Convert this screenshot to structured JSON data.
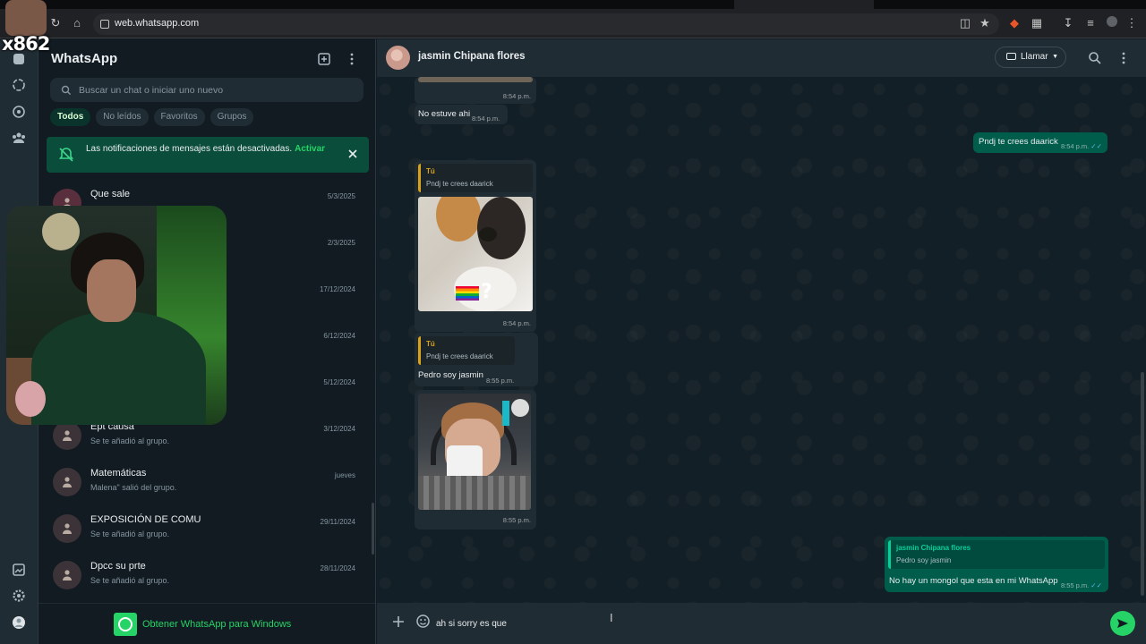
{
  "browser": {
    "url": "web.whatsapp.com"
  },
  "sidebar": {
    "title": "WhatsApp",
    "search_placeholder": "Buscar un chat o iniciar uno nuevo",
    "filters": [
      "Todos",
      "No leídos",
      "Favoritos",
      "Grupos"
    ],
    "active_filter": "Todos",
    "notice": {
      "text": "Las notificaciones de mensajes están desactivadas.",
      "link": "Activar"
    },
    "chats": [
      {
        "name": "Que sale",
        "preview": "",
        "date": "5/3/2025"
      },
      {
        "name": "",
        "preview": "",
        "date": "2/3/2025"
      },
      {
        "name": "",
        "preview": "",
        "date": "17/12/2024"
      },
      {
        "name": "",
        "preview": "",
        "date": "6/12/2024"
      },
      {
        "name": "",
        "preview": "",
        "date": "5/12/2024"
      },
      {
        "name": "Ept causa",
        "preview": "Se te añadió al grupo.",
        "date": "3/12/2024"
      },
      {
        "name": "Matemáticas",
        "preview": "Malena\" salió del grupo.",
        "date": "jueves"
      },
      {
        "name": "EXPOSICIÓN DE COMU",
        "preview": "Se te añadió al grupo.",
        "date": "29/11/2024"
      },
      {
        "name": "Dpcc su prte",
        "preview": "Se te añadió al grupo.",
        "date": "28/11/2024"
      }
    ],
    "footer_text": "Obtener WhatsApp para Windows"
  },
  "streamer": {
    "label": "x862"
  },
  "conversation": {
    "contact_name": "jasmin Chipana flores",
    "call_label": "Llamar",
    "messages": {
      "m1_time": "8:54 p.m.",
      "m2_text": "No estuve ahi",
      "m2_time": "8:54 p.m.",
      "m3_text": "Pndj te crees daarick",
      "m3_time": "8:54 p.m.",
      "m4_quote_author": "Tú",
      "m4_quote_text": "Pndj te crees daarick",
      "m4_time": "8:54 p.m.",
      "m5_quote_author": "Tú",
      "m5_quote_text": "Pndj te crees daarick",
      "m5_text": "Pedro soy jasmin",
      "m5_time": "8:55 p.m.",
      "m6_time": "8:55 p.m.",
      "m7_quote_author": "jasmin Chipana flores",
      "m7_quote_text": "Pedro soy jasmin",
      "m7_text": "No hay un mongol que esta en mi WhatsApp",
      "m7_time": "8:55 p.m."
    },
    "composer_value": "ah si sorry es que"
  },
  "colors": {
    "accent": "#25d366",
    "outgoing_bubble": "#005c4b",
    "incoming_bubble": "#202c33",
    "reply_bar_self": "#d8a21a",
    "reply_bar_contact": "#06cf9c"
  }
}
